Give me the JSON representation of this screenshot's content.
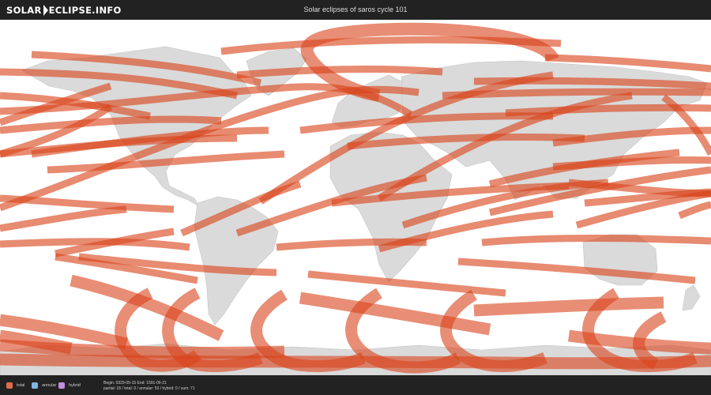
{
  "header": {
    "logo_left": "SOLAR",
    "logo_right": "ECLIPSE.INFO",
    "title": "Solar eclipses of saros cycle 101"
  },
  "colors": {
    "total": "#e36c4f",
    "annular": "#7fb7e0",
    "hybrid": "#c48ddb",
    "land": "#dadada",
    "ocean": "#ffffff",
    "bars": "#222222"
  },
  "legend": {
    "total": "total",
    "annular": "annular",
    "hybrid": "hybrid"
  },
  "stats": {
    "line1": "Begin: 0329-05-15 End: 1591-06-21",
    "line2": "partial: 18 / total: 0 / annular: 53 / hybrid: 0 / sum: 71"
  }
}
